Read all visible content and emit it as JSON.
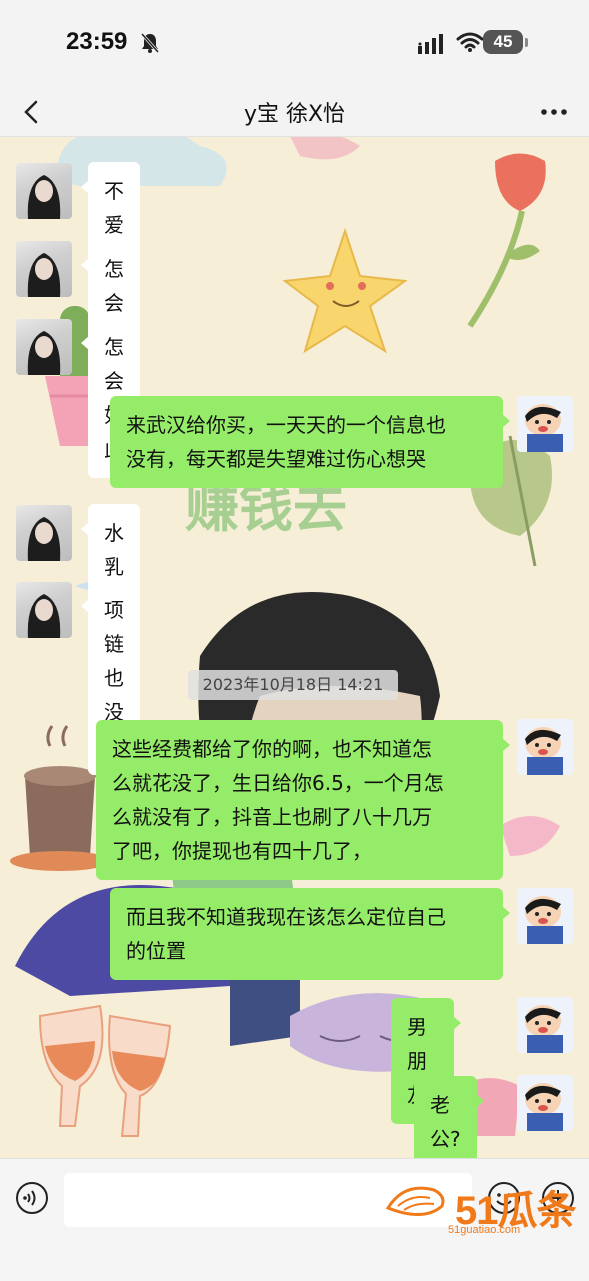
{
  "status_bar": {
    "time": "23:59",
    "battery": "45",
    "icons": [
      "bell-muted-icon",
      "signal-icon",
      "wifi-icon",
      "battery-icon"
    ]
  },
  "header": {
    "title": "y宝 徐X怡",
    "back_icon": "chevron-left-icon",
    "more_icon": "more-dots-icon"
  },
  "messages": [
    {
      "from": "her",
      "text": "不爱了"
    },
    {
      "from": "her",
      "text": "怎会这样"
    },
    {
      "from": "her",
      "text": "怎会如此"
    },
    {
      "from": "me",
      "lines": [
        "来武汉给你买，一天天的一个信息也",
        "没有，每天都是失望难过伤心想哭"
      ]
    },
    {
      "from": "her",
      "text": "水乳也没有"
    },
    {
      "from": "her",
      "text": "项链也没有"
    },
    {
      "from": "me",
      "lines": [
        "这些经费都给了你的啊，也不知道怎",
        "么就花没了，生日给你6.5，一个月怎",
        "么就没有了，抖音上也刷了八十几万",
        "了吧，你提现也有四十几了，"
      ]
    },
    {
      "from": "me",
      "lines": [
        "而且我不知道我现在该怎么定位自己",
        "的位置"
      ]
    },
    {
      "from": "me",
      "text": "男朋友?"
    },
    {
      "from": "me",
      "text": "老公?"
    }
  ],
  "timestamp": "2023年10月18日 14:21",
  "background_text": "赚钱去",
  "input_bar": {
    "placeholder": "",
    "icons": [
      "voice-icon",
      "emoji-icon",
      "plus-icon"
    ]
  },
  "watermark": {
    "text": "51瓜条",
    "url": "51guatiao.com"
  },
  "colors": {
    "green_bubble": "#95ec69",
    "white_bubble": "#ffffff",
    "bar_bg": "#f3f3f3",
    "chat_bg": "#f6eed7"
  }
}
